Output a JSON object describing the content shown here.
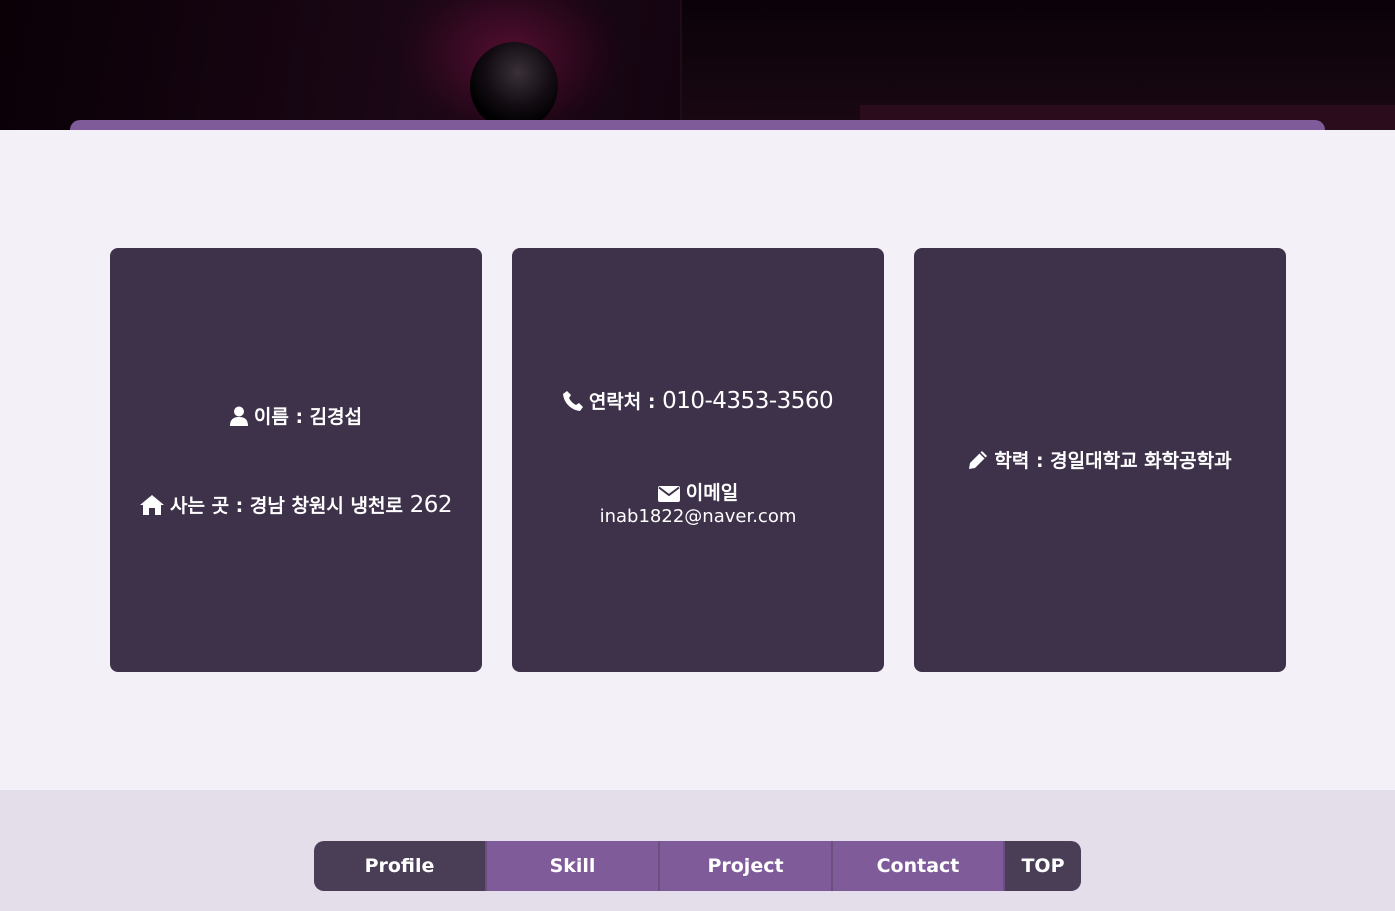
{
  "nav": {
    "profile": "Profile",
    "skill": "Skill",
    "project": "Project",
    "contact": "Contact",
    "top": "TOP"
  },
  "cards": {
    "info": {
      "name_label": "이름 : 김경섭",
      "address_label": "사는 곳 : 경남 창원시 냉천로",
      "address_number": "262"
    },
    "contact": {
      "phone_label": "연락처 :",
      "phone_value": "010-4353-3560",
      "email_label": "이메일",
      "email_value": "inab1822@naver.com"
    },
    "education": {
      "label": "학력 : 경일대학교 화학공학과"
    }
  },
  "icons": {
    "user": "user-icon",
    "home": "home-icon",
    "phone": "phone-icon",
    "mail": "envelope-icon",
    "pencil": "pencil-icon"
  },
  "colors": {
    "accent": "#7f5c99",
    "card": "#3e314a",
    "active_nav": "#4a3e56"
  }
}
